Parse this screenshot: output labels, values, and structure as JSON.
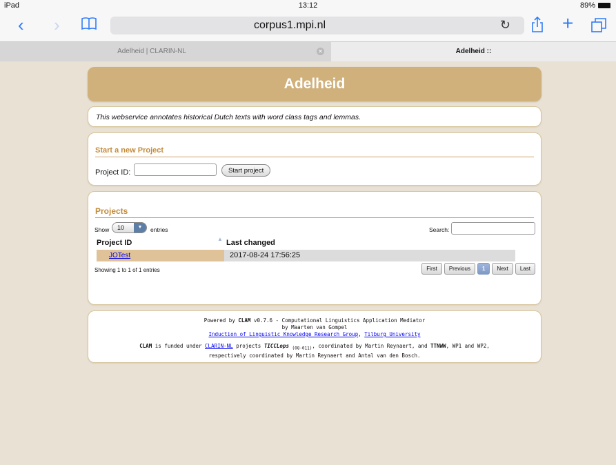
{
  "status_bar": {
    "device": "iPad",
    "time": "13:12",
    "battery": "89%"
  },
  "browser": {
    "url": "corpus1.mpi.nl"
  },
  "tabs": [
    {
      "label": "Adelheid | CLARIN-NL"
    },
    {
      "label": "Adelheid ::"
    }
  ],
  "header": {
    "title": "Adelheid"
  },
  "description": "This webservice annotates historical Dutch texts with word class tags and lemmas.",
  "new_project": {
    "title": "Start a new Project",
    "id_label": "Project ID:",
    "id_value": "",
    "start_label": "Start project"
  },
  "projects": {
    "title": "Projects",
    "show_label": "Show",
    "show_value": "10",
    "entries_label": "entries",
    "search_label": "Search:",
    "search_value": "",
    "columns": [
      "Project ID",
      "Last changed"
    ],
    "rows": [
      {
        "id": "JOTest",
        "changed": "2017-08-24 17:56:25"
      }
    ],
    "info": "Showing 1 to 1 of 1 entries",
    "pager": {
      "first": "First",
      "previous": "Previous",
      "current": "1",
      "next": "Next",
      "last": "Last"
    }
  },
  "footer": {
    "l1_pre": "Powered by",
    "clam": "CLAM",
    "l1_post": "v0.7.6 - Computational Linguistics Application Mediator",
    "l2": "by Maarten van Gompel",
    "link1": "Induction of Linguistic Knowledge Research Group",
    "sep": ",",
    "link2": "Tilburg University",
    "l4_a": "is funded under",
    "clarin_link": "CLARIN-NL",
    "l4_b": "projects",
    "ticclops": "TICCLops",
    "ticclops_sub": "(08-011)",
    "l4_c": ", coordinated by Martin Reynaert, and",
    "ttnww": "TTNWW",
    "l4_d": ", WP1 and WP2,",
    "l5": "respectively coordinated by Martin Reynaert and Antal van den Bosch."
  }
}
